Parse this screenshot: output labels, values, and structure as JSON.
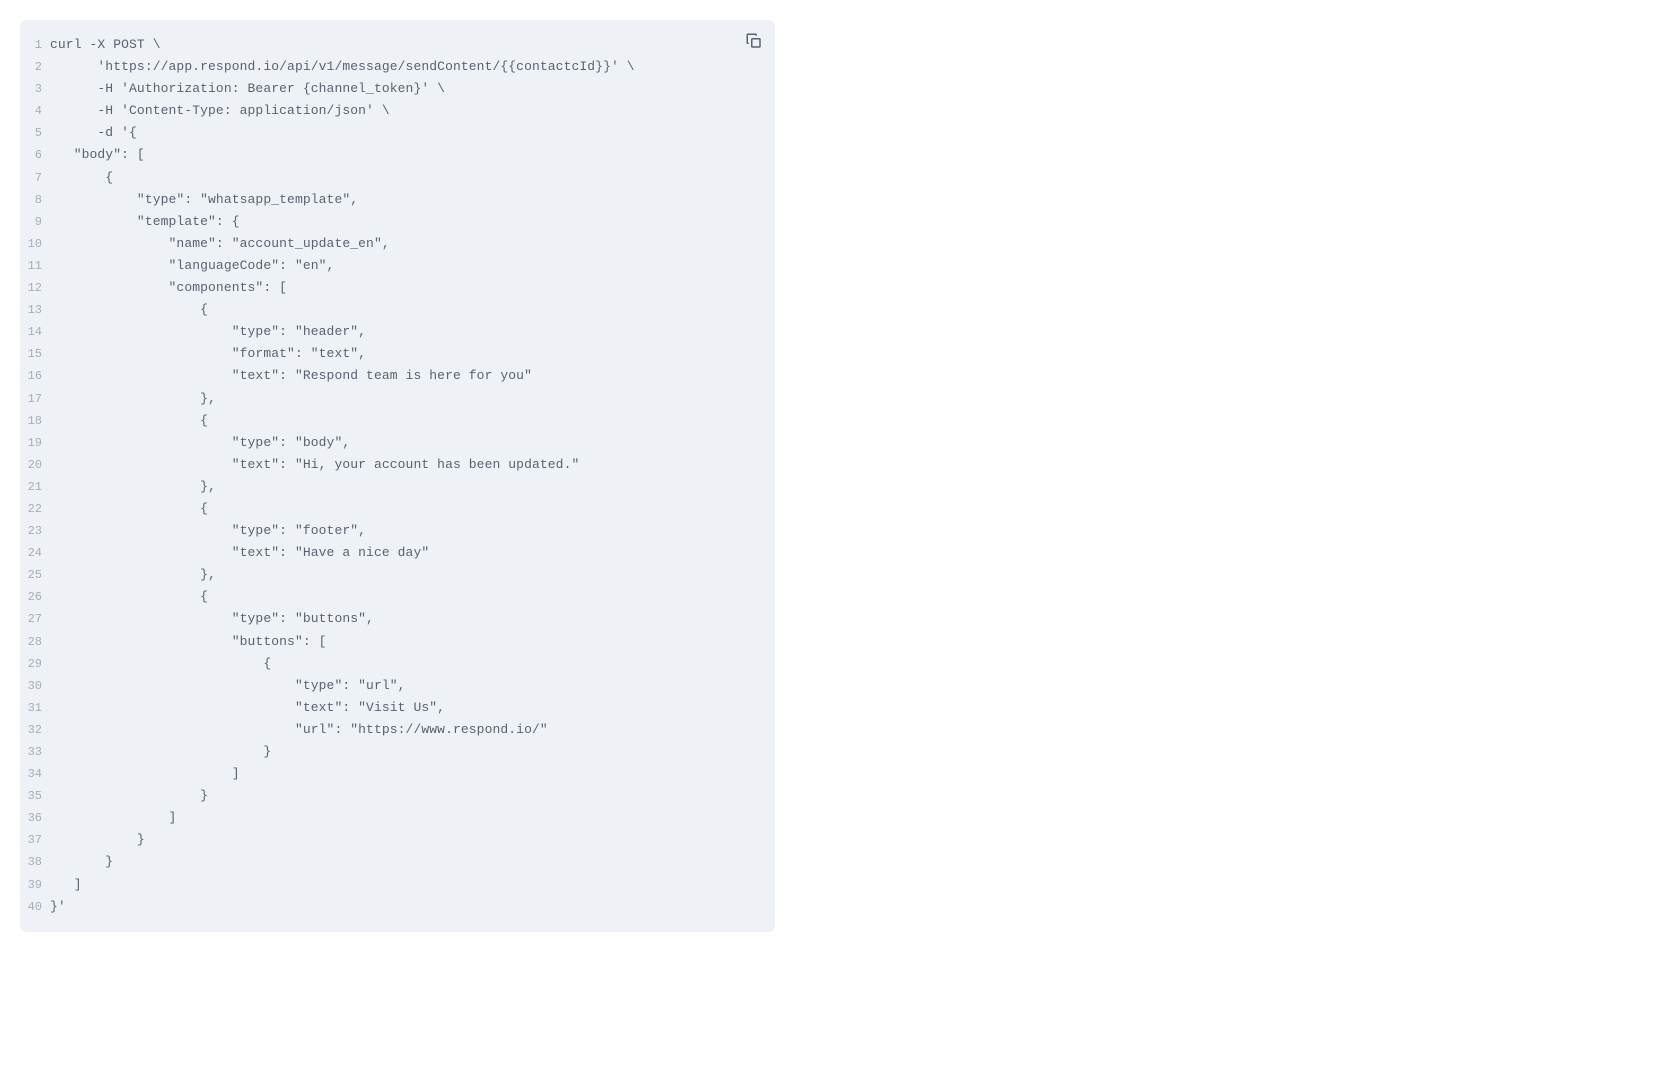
{
  "code_lines": [
    {
      "num": "1",
      "text": "curl -X POST \\"
    },
    {
      "num": "2",
      "text": "      'https://app.respond.io/api/v1/message/sendContent/{{contactcId}}' \\"
    },
    {
      "num": "3",
      "text": "      -H 'Authorization: Bearer {channel_token}' \\"
    },
    {
      "num": "4",
      "text": "      -H 'Content-Type: application/json' \\"
    },
    {
      "num": "5",
      "text": "      -d '{"
    },
    {
      "num": "6",
      "text": "   \"body\": ["
    },
    {
      "num": "7",
      "text": "       {"
    },
    {
      "num": "8",
      "text": "           \"type\": \"whatsapp_template\","
    },
    {
      "num": "9",
      "text": "           \"template\": {"
    },
    {
      "num": "10",
      "text": "               \"name\": \"account_update_en\","
    },
    {
      "num": "11",
      "text": "               \"languageCode\": \"en\","
    },
    {
      "num": "12",
      "text": "               \"components\": ["
    },
    {
      "num": "13",
      "text": "                   {"
    },
    {
      "num": "14",
      "text": "                       \"type\": \"header\","
    },
    {
      "num": "15",
      "text": "                       \"format\": \"text\","
    },
    {
      "num": "16",
      "text": "                       \"text\": \"Respond team is here for you\""
    },
    {
      "num": "17",
      "text": "                   },"
    },
    {
      "num": "18",
      "text": "                   {"
    },
    {
      "num": "19",
      "text": "                       \"type\": \"body\","
    },
    {
      "num": "20",
      "text": "                       \"text\": \"Hi, your account has been updated.\""
    },
    {
      "num": "21",
      "text": "                   },"
    },
    {
      "num": "22",
      "text": "                   {"
    },
    {
      "num": "23",
      "text": "                       \"type\": \"footer\","
    },
    {
      "num": "24",
      "text": "                       \"text\": \"Have a nice day\""
    },
    {
      "num": "25",
      "text": "                   },"
    },
    {
      "num": "26",
      "text": "                   {"
    },
    {
      "num": "27",
      "text": "                       \"type\": \"buttons\","
    },
    {
      "num": "28",
      "text": "                       \"buttons\": ["
    },
    {
      "num": "29",
      "text": "                           {"
    },
    {
      "num": "30",
      "text": "                               \"type\": \"url\","
    },
    {
      "num": "31",
      "text": "                               \"text\": \"Visit Us\","
    },
    {
      "num": "32",
      "text": "                               \"url\": \"https://www.respond.io/\""
    },
    {
      "num": "33",
      "text": "                           }"
    },
    {
      "num": "34",
      "text": "                       ]"
    },
    {
      "num": "35",
      "text": "                   }"
    },
    {
      "num": "36",
      "text": "               ]"
    },
    {
      "num": "37",
      "text": "           }"
    },
    {
      "num": "38",
      "text": "       }"
    },
    {
      "num": "39",
      "text": "   ]"
    },
    {
      "num": "40",
      "text": "}'"
    }
  ]
}
